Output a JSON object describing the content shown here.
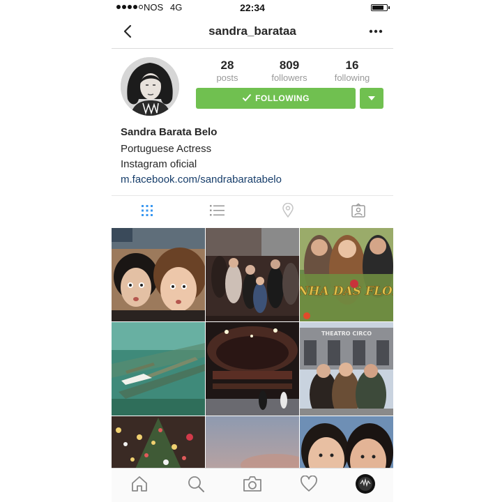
{
  "status_bar": {
    "carrier": "NOS",
    "network": "4G",
    "time": "22:34",
    "signal_bars": 4,
    "battery_level": 0.8
  },
  "nav": {
    "title": "sandra_barataa",
    "back_icon": "chevron-left-icon",
    "more_icon": "more-horizontal-icon"
  },
  "profile": {
    "avatar_icon": "profile-photo",
    "stats": [
      {
        "value": "28",
        "label": "posts"
      },
      {
        "value": "809",
        "label": "followers"
      },
      {
        "value": "16",
        "label": "following"
      }
    ],
    "following_label": "FOLLOWING",
    "accent_color": "#70c050"
  },
  "bio": {
    "name": "Sandra Barata Belo",
    "lines": [
      "Portuguese Actress",
      "Instagram oficial"
    ],
    "link": "m.facebook.com/sandrabaratabelo"
  },
  "view_tabs": [
    {
      "icon": "grid-icon",
      "active": true
    },
    {
      "icon": "list-icon",
      "active": false
    },
    {
      "icon": "location-pin-icon",
      "active": false
    },
    {
      "icon": "tagged-photos-icon",
      "active": false
    }
  ],
  "tab_bar": [
    {
      "icon": "home-icon"
    },
    {
      "icon": "search-icon"
    },
    {
      "icon": "camera-icon"
    },
    {
      "icon": "heart-icon"
    },
    {
      "icon": "profile-icon"
    }
  ],
  "grid": {
    "thumb_3_title": "RAINHA DAS FLORES",
    "thumb_6_sign": "THEATRO CIRCO"
  }
}
